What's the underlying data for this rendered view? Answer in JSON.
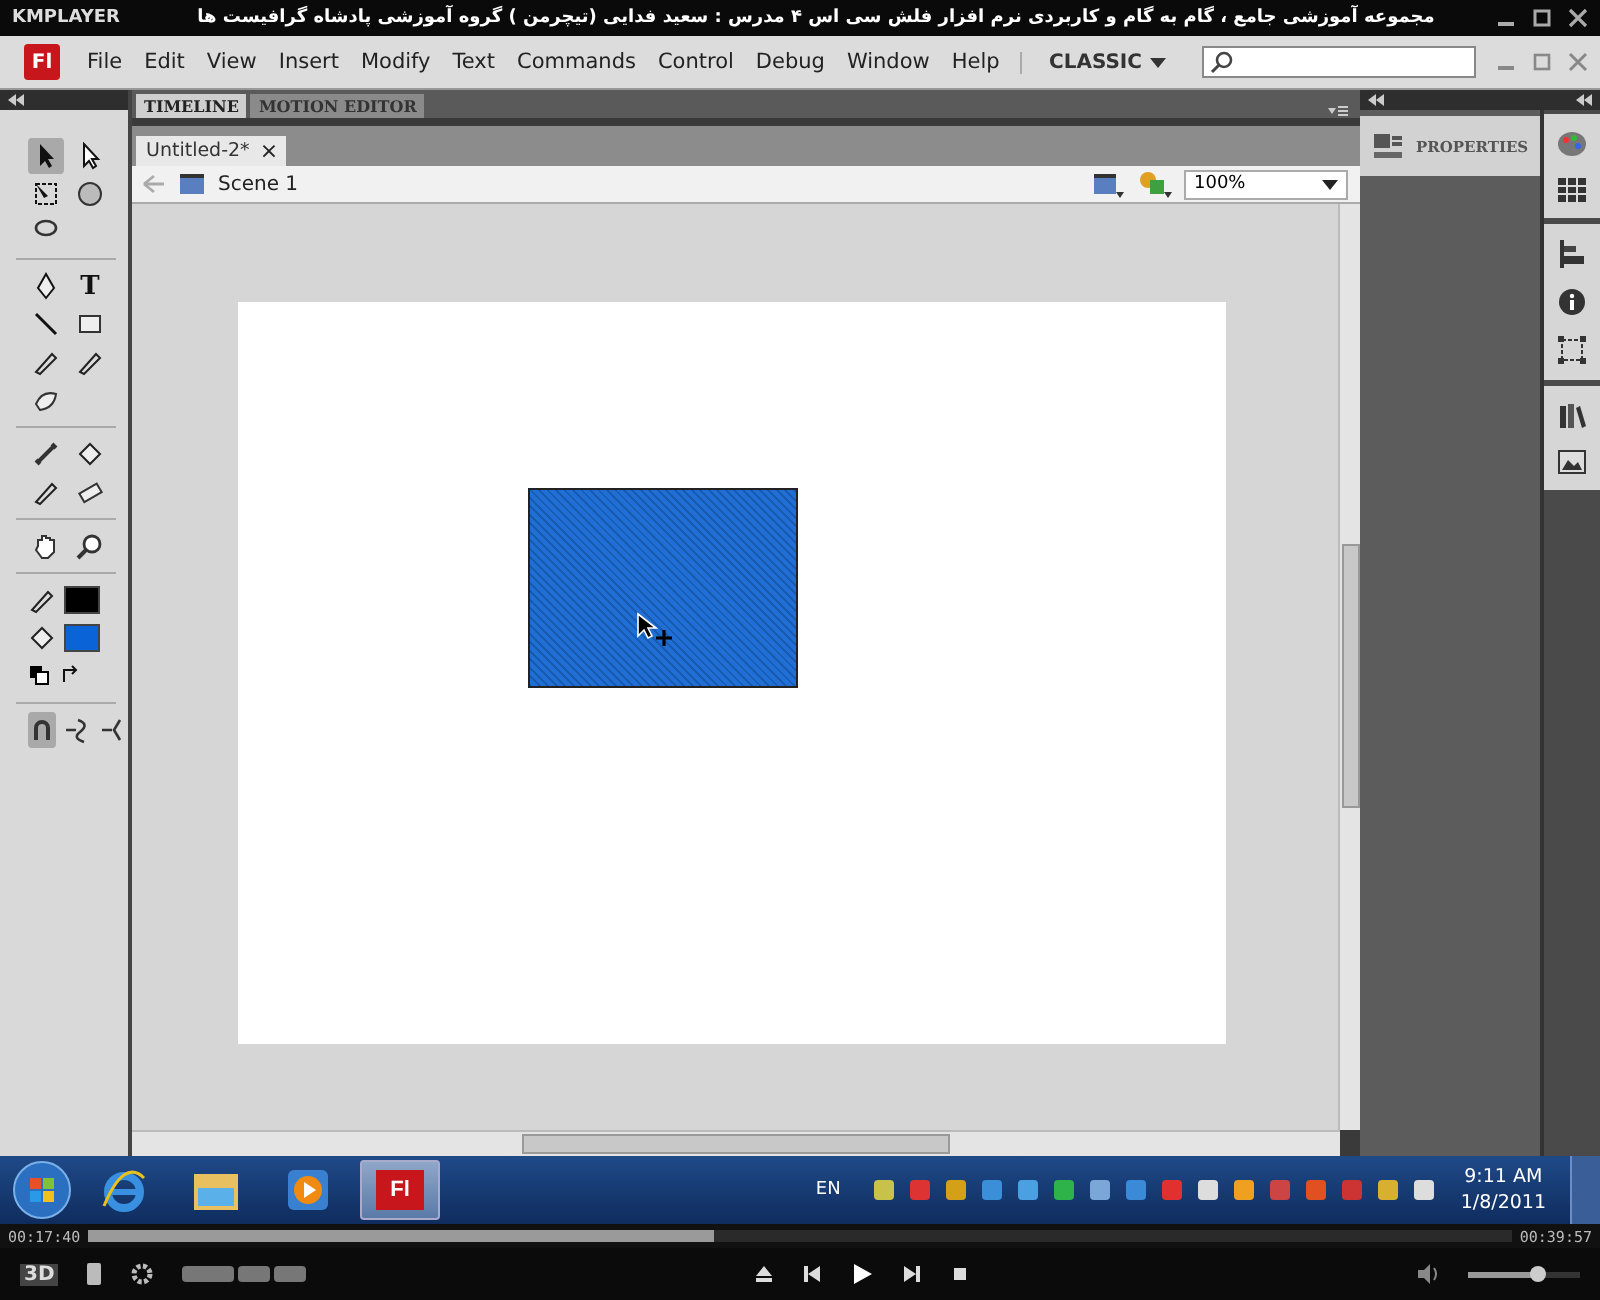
{
  "player": {
    "logo": "KMPLAYER",
    "title": "مجموعه آموزشی جامع ، گام به گام و کاربردی نرم افزار فلش سی اس ۴ مدرس : سعید فدایی (تیچرمن ) گروه آموزشی پادشاه گرافیست ها"
  },
  "app": {
    "logo": "Fl",
    "menu": [
      "File",
      "Edit",
      "View",
      "Insert",
      "Modify",
      "Text",
      "Commands",
      "Control",
      "Debug",
      "Window",
      "Help"
    ],
    "workspace": "CLASSIC"
  },
  "tools": [
    [
      {
        "kind": "arrow",
        "selected": true
      },
      {
        "kind": "subselect",
        "selected": false
      }
    ],
    [
      {
        "kind": "transform",
        "selected": false
      },
      {
        "kind": "rotate3d",
        "selected": false
      }
    ],
    [
      {
        "kind": "lasso",
        "selected": false
      }
    ],
    [
      {
        "kind": "pen",
        "selected": false
      },
      {
        "kind": "text",
        "label": "T",
        "selected": false
      }
    ],
    [
      {
        "kind": "line",
        "selected": false
      },
      {
        "kind": "rect",
        "selected": false
      }
    ],
    [
      {
        "kind": "pencil",
        "selected": false
      },
      {
        "kind": "brush",
        "selected": false
      }
    ],
    [
      {
        "kind": "deco",
        "selected": false
      }
    ],
    [
      {
        "kind": "bone",
        "selected": false
      },
      {
        "kind": "bucket",
        "selected": false
      }
    ],
    [
      {
        "kind": "eyedropper",
        "selected": false
      },
      {
        "kind": "eraser",
        "selected": false
      }
    ],
    [
      {
        "kind": "hand",
        "selected": false
      },
      {
        "kind": "zoom",
        "selected": false
      }
    ]
  ],
  "swatches": [
    {
      "kind": "stroke",
      "color": "#000000"
    },
    {
      "kind": "fill",
      "color": "#0a64d8"
    }
  ],
  "options": [
    {
      "kind": "snap",
      "selected": true
    },
    {
      "kind": "smooth",
      "selected": false
    },
    {
      "kind": "straighten",
      "selected": false
    }
  ],
  "panel_tabs": [
    {
      "label": "TIMELINE",
      "selected": true
    },
    {
      "label": "MOTION EDITOR",
      "selected": false
    }
  ],
  "document": {
    "tab": "Untitled-2*",
    "close": "×",
    "scene": "Scene 1",
    "zoom": "100%"
  },
  "properties": {
    "label": "PROPERTIES"
  },
  "taskbar": {
    "apps": [
      {
        "kind": "ie",
        "selected": false
      },
      {
        "kind": "explorer",
        "selected": false
      },
      {
        "kind": "media",
        "selected": false
      },
      {
        "kind": "flash",
        "label": "Fl",
        "selected": true
      }
    ],
    "language": "EN",
    "time": "9:11 AM",
    "date": "1/8/2011"
  },
  "playback": {
    "elapsed": "00:17:40",
    "total": "00:39:57",
    "level": 0.44,
    "badge": "3D",
    "volume": {
      "level": 0.62
    }
  }
}
